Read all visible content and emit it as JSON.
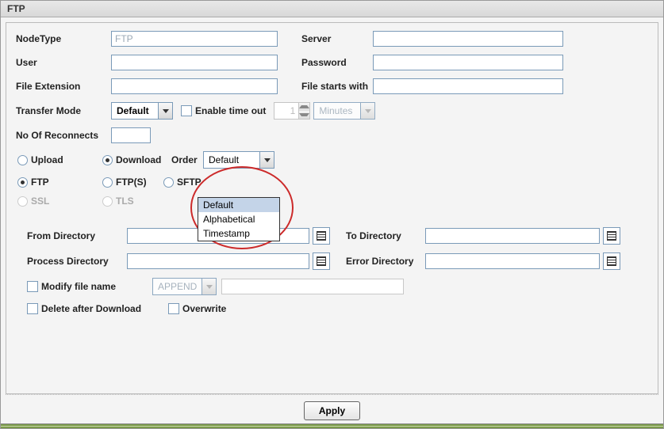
{
  "window": {
    "title": "FTP"
  },
  "labels": {
    "nodeType": "NodeType",
    "server": "Server",
    "user": "User",
    "password": "Password",
    "fileExtension": "File Extension",
    "fileStartsWith": "File starts with",
    "transferMode": "Transfer Mode",
    "enableTimeout": "Enable time out",
    "noReconnects": "No Of Reconnects",
    "order": "Order",
    "fromDir": "From Directory",
    "toDir": "To Directory",
    "processDir": "Process Directory",
    "errorDir": "Error Directory",
    "modifyFileName": "Modify file name",
    "deleteAfterDownload": "Delete after Download",
    "overwrite": "Overwrite",
    "apply": "Apply"
  },
  "values": {
    "nodeType": "FTP",
    "server": "",
    "user": "",
    "password": "",
    "fileExtension": "",
    "fileStartsWith": "",
    "transferMode": "Default",
    "timeoutValue": "1",
    "timeoutUnit": "Minutes",
    "noReconnects": "",
    "orderSelected": "Default",
    "modifyMode": "APPEND",
    "modifyValue": "",
    "fromDir": "",
    "toDir": "",
    "processDir": "",
    "errorDir": ""
  },
  "radios": {
    "upload": "Upload",
    "download": "Download",
    "ftp": "FTP",
    "ftps": "FTP(S)",
    "sftp": "SFTP",
    "ssl": "SSL",
    "tls": "TLS"
  },
  "orderOptions": [
    "Default",
    "Alphabetical",
    "Timestamp"
  ]
}
